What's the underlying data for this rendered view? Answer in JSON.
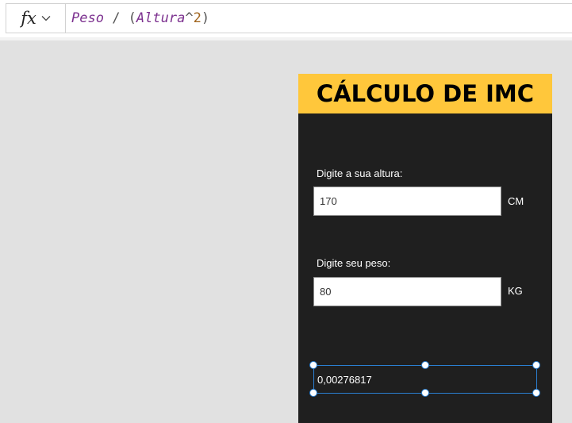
{
  "formula_bar": {
    "fx_label": "fx",
    "formula_tokens": [
      {
        "text": "Peso",
        "kind": "ident"
      },
      {
        "text": " / (",
        "kind": "op"
      },
      {
        "text": "Altura",
        "kind": "ident"
      },
      {
        "text": "^",
        "kind": "op"
      },
      {
        "text": "2",
        "kind": "num"
      },
      {
        "text": ")",
        "kind": "op"
      }
    ]
  },
  "app": {
    "title": "CÁLCULO DE IMC",
    "height_field": {
      "label": "Digite a sua altura:",
      "value": "170",
      "unit": "CM"
    },
    "weight_field": {
      "label": "Digite seu peso:",
      "value": "80",
      "unit": "KG"
    },
    "result": {
      "value": "0,00276817"
    }
  },
  "colors": {
    "header_bg": "#ffc73b",
    "screen_bg": "#1f1f1f",
    "canvas_bg": "#e1e1e1",
    "selection": "#2a7fd1",
    "formula_identifier": "#7c318f",
    "formula_number": "#a0641d"
  },
  "icons": {
    "formula": "fx-icon",
    "dropdown": "chevron-down-icon"
  }
}
